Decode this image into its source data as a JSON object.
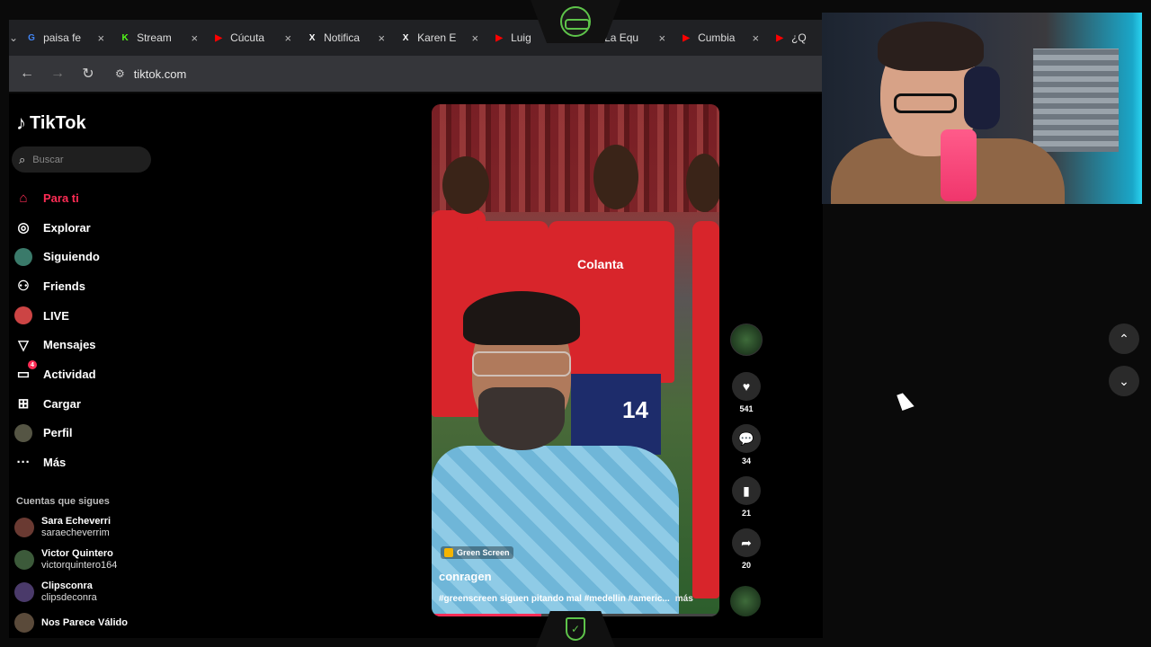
{
  "browser": {
    "tabs": [
      {
        "label": "paisa fe",
        "icon": "google-icon",
        "color": "#4285f4"
      },
      {
        "label": "Stream",
        "icon": "kick-icon",
        "color": "#53fc18"
      },
      {
        "label": "Cúcuta",
        "icon": "youtube-icon",
        "color": "#ff0000"
      },
      {
        "label": "Notifica",
        "icon": "x-icon",
        "color": "#ffffff"
      },
      {
        "label": "Karen E",
        "icon": "x-icon",
        "color": "#ffffff"
      },
      {
        "label": "Luig",
        "icon": "youtube-icon",
        "color": "#ff0000"
      },
      {
        "label": "La Equ",
        "icon": "youtube-icon",
        "color": "#ff0000"
      },
      {
        "label": "Cumbia",
        "icon": "youtube-icon",
        "color": "#ff0000"
      },
      {
        "label": "¿Q",
        "icon": "youtube-icon",
        "color": "#ff0000"
      }
    ],
    "url": "tiktok.com"
  },
  "sidebar": {
    "brand": "TikTok",
    "search_placeholder": "Buscar",
    "items": [
      {
        "label": "Para ti",
        "icon": "home-icon",
        "active": true
      },
      {
        "label": "Explorar",
        "icon": "compass-icon"
      },
      {
        "label": "Siguiendo",
        "icon": "following-avatar-icon"
      },
      {
        "label": "Friends",
        "icon": "friends-icon"
      },
      {
        "label": "LIVE",
        "icon": "live-avatar-icon"
      },
      {
        "label": "Mensajes",
        "icon": "send-icon"
      },
      {
        "label": "Actividad",
        "icon": "activity-icon",
        "badge": "4"
      },
      {
        "label": "Cargar",
        "icon": "upload-icon"
      },
      {
        "label": "Perfil",
        "icon": "profile-avatar-icon"
      },
      {
        "label": "Más",
        "icon": "more-icon"
      }
    ],
    "following_title": "Cuentas que sigues",
    "following": [
      {
        "name": "Sara Echeverri",
        "username": "saraecheverrim",
        "color": "#6a3a32"
      },
      {
        "name": "Victor Quintero",
        "username": "victorquintero164",
        "color": "#3c5a3a"
      },
      {
        "name": "Clipsconra",
        "username": "clipsdeconra",
        "color": "#4a3a6a"
      },
      {
        "name": "Nos Parece Válido",
        "username": "",
        "color": "#5a4a3a"
      }
    ]
  },
  "video": {
    "badge": "Green Screen",
    "username": "conragen",
    "description": "#greenscreen siguen pitando mal #medellin #americ...",
    "more": "más",
    "jersey_number": "14",
    "sponsor": "Colanta",
    "progress": 0.38
  },
  "actions": {
    "likes": "541",
    "comments": "34",
    "saves": "21",
    "shares": "20"
  }
}
